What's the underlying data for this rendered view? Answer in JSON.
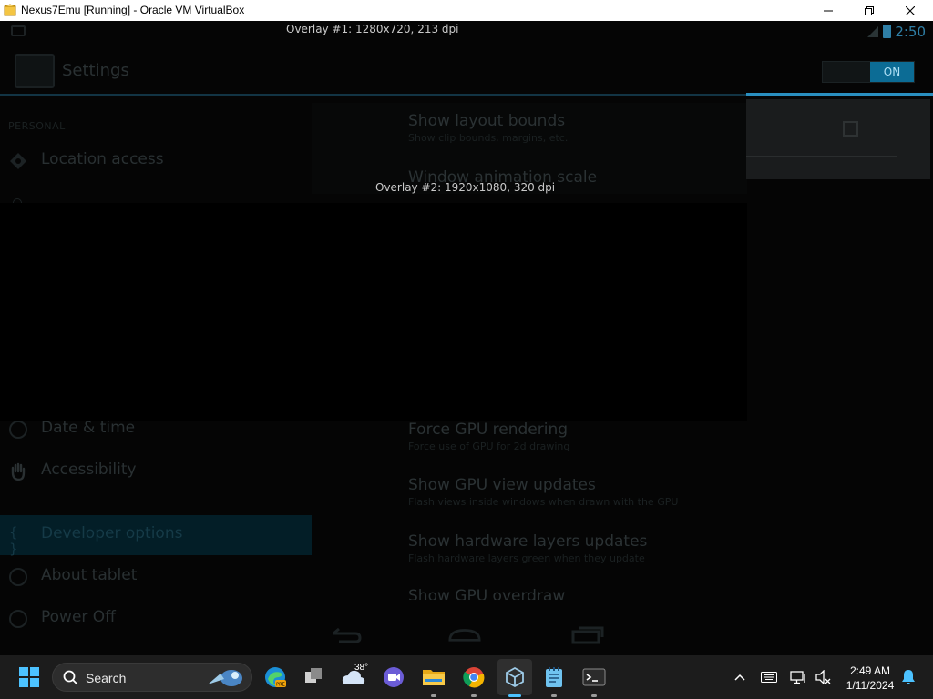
{
  "window": {
    "title": "Nexus7Emu [Running] - Oracle VM VirtualBox",
    "buttons": [
      "minimize",
      "maximize",
      "close"
    ]
  },
  "guest": {
    "overlay1": "Overlay #1: 1280x720, 213 dpi",
    "overlay2": "Overlay #2: 1920x1080, 320 dpi",
    "clock": "2:50",
    "app_title": "Settings",
    "toggle_label": "ON",
    "section_header": "PERSONAL",
    "left_items": [
      {
        "label": "Location access",
        "icon": "location-icon"
      },
      {
        "label": "Date & time",
        "icon": "clock-icon"
      },
      {
        "label": "Accessibility",
        "icon": "hand-icon"
      },
      {
        "label": "Developer options",
        "icon": "braces-icon",
        "selected": true
      },
      {
        "label": "About tablet",
        "icon": "info-icon"
      },
      {
        "label": "Power Off",
        "icon": "power-icon"
      }
    ],
    "right_items_top": [
      {
        "title": "Show layout bounds",
        "summary": "Show clip bounds, margins, etc."
      },
      {
        "title": "Window animation scale",
        "summary": ""
      }
    ],
    "right_items_bottom": [
      {
        "title": "Force GPU rendering",
        "summary": "Force use of GPU for 2d drawing"
      },
      {
        "title": "Show GPU view updates",
        "summary": "Flash views inside windows when drawn with the GPU"
      },
      {
        "title": "Show hardware layers updates",
        "summary": "Flash hardware layers green when they update"
      },
      {
        "title": "Show GPU overdraw",
        "summary": ""
      }
    ]
  },
  "taskbar": {
    "search_label": "Search",
    "weather_temp": "38°",
    "time": "2:49 AM",
    "date": "1/11/2024",
    "apps": [
      "windows-start-icon",
      "edge-icon",
      "task-view-icon",
      "weather-icon",
      "teams-icon",
      "file-explorer-icon",
      "chrome-icon",
      "virtualbox-icon",
      "notepad-icon",
      "terminal-icon"
    ]
  }
}
